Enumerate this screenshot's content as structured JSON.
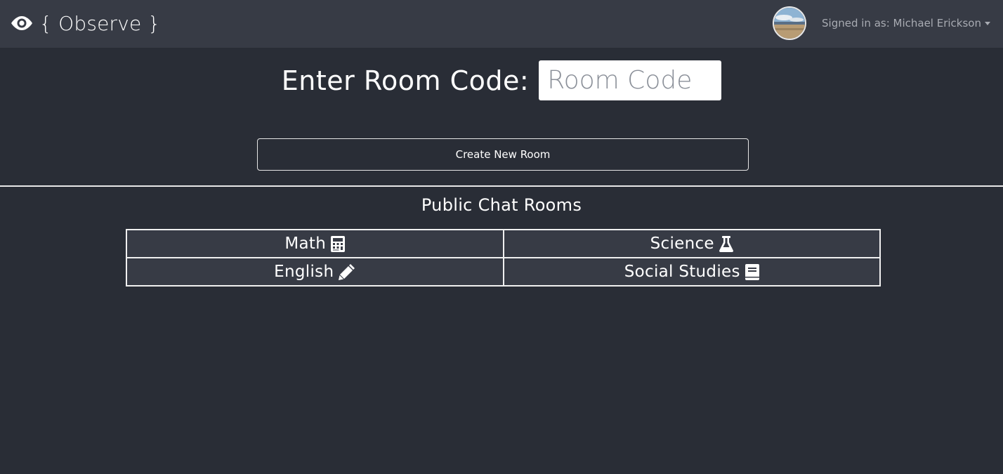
{
  "navbar": {
    "brand_icon": "eye-icon",
    "brand_text": "{ Observe }",
    "signed_in_text": "Signed in as: Michael Erickson",
    "dropdown_icon": "caret-down-icon"
  },
  "room_entry": {
    "label": "Enter Room Code:",
    "placeholder": "Room Code",
    "value": ""
  },
  "create_button": {
    "label": "Create New Room"
  },
  "public_rooms": {
    "title": "Public Chat Rooms",
    "rooms": [
      {
        "label": "Math",
        "icon": "calculator-icon"
      },
      {
        "label": "Science",
        "icon": "flask-icon"
      },
      {
        "label": "English",
        "icon": "pencil-icon"
      },
      {
        "label": "Social Studies",
        "icon": "book-icon"
      }
    ]
  },
  "colors": {
    "background": "#292d36",
    "navbar": "#373b45",
    "table_cell": "#373b45",
    "border": "#f0f0f0",
    "muted_text": "#a8abb2"
  }
}
